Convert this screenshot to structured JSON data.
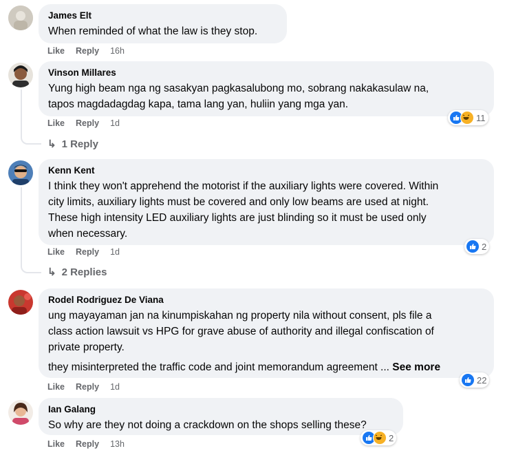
{
  "comments": [
    {
      "author": "James Elt",
      "text": "When reminded of what the law is they stop.",
      "like": "Like",
      "reply": "Reply",
      "time": "16h"
    },
    {
      "author": "Vinson Millares",
      "text": "Yung high beam nga ng sasakyan pagkasalubong mo, sobrang nakakasulaw na,\ntapos magdadagdag kapa, tama lang yan, huliin yang mga yan.",
      "like": "Like",
      "reply": "Reply",
      "time": "1d",
      "reactions": "11",
      "reactions_icons": [
        "like-icon",
        "haha-icon"
      ],
      "replies_label": "1 Reply"
    },
    {
      "author": "Kenn Kent",
      "text": "I think they won't apprehend the motorist if the auxiliary lights were covered. Within\ncity limits, auxiliary lights must be covered and only low beams are used at night.\nThese high intensity LED auxiliary lights are just blinding so it must be used only\nwhen necessary.",
      "like": "Like",
      "reply": "Reply",
      "time": "1d",
      "reactions": "2",
      "reactions_icons": [
        "like-icon"
      ],
      "replies_label": "2 Replies"
    },
    {
      "author": "Rodel Rodriguez De Viana",
      "text": "ung mayayaman jan na kinumpiskahan ng property nila without consent, pls file a\nclass action lawsuit vs HPG for grave abuse of authority and illegal confiscation of\nprivate property.",
      "text2": "they misinterpreted the traffic code and joint memorandum agreement ...",
      "see_more": "See more",
      "like": "Like",
      "reply": "Reply",
      "time": "1d",
      "reactions": "22",
      "reactions_icons": [
        "like-icon"
      ]
    },
    {
      "author": "Ian Galang",
      "text": "So why are they not doing a crackdown on the shops selling these?",
      "like": "Like",
      "reply": "Reply",
      "time": "13h",
      "reactions": "2",
      "reactions_icons": [
        "like-icon",
        "haha-icon"
      ]
    }
  ],
  "colors": {
    "bubble": "#f0f2f5",
    "like_blue": "#1877f2",
    "haha_yellow": "#f7b125",
    "meta_gray": "#65676b"
  }
}
